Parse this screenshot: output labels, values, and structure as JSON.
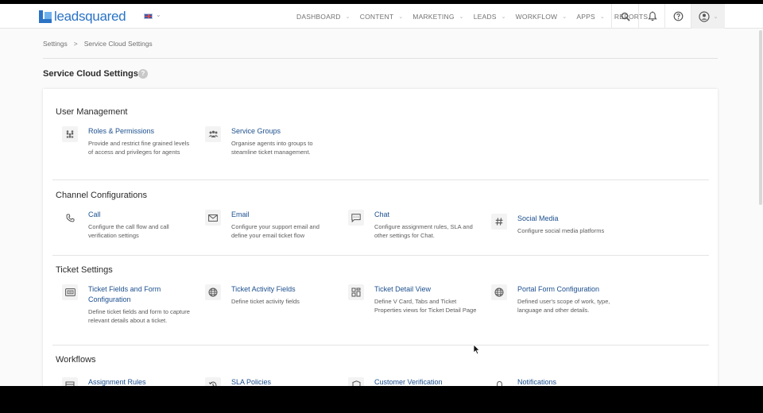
{
  "header": {
    "logo_text": "leadsquared",
    "nav": [
      "DASHBOARD",
      "CONTENT",
      "MARKETING",
      "LEADS",
      "WORKFLOW",
      "APPS",
      "REPORTS"
    ],
    "icons": [
      "search-icon",
      "bell-icon",
      "help-icon",
      "user-icon"
    ]
  },
  "breadcrumb": {
    "root": "Settings",
    "separator": ">",
    "current": "Service Cloud Settings"
  },
  "page": {
    "title": "Service Cloud Settings",
    "help_glyph": "?"
  },
  "sections": {
    "user_management": {
      "title": "User Management",
      "items": [
        {
          "title": "Roles & Permissions",
          "desc": "Provide and restrict fine grained levels of access and privileges for agents",
          "icon": "roles-icon"
        },
        {
          "title": "Service Groups",
          "desc": "Organise agents into groups to steamline ticket management.",
          "icon": "groups-icon"
        }
      ]
    },
    "channel_configurations": {
      "title": "Channel Configurations",
      "items": [
        {
          "title": "Call",
          "desc": "Configure the call flow and call verification settings",
          "icon": "phone-icon"
        },
        {
          "title": "Email",
          "desc": "Configure your support email and define your email ticket flow",
          "icon": "mail-icon"
        },
        {
          "title": "Chat",
          "desc": "Configure assignment rules, SLA and other settings for Chat.",
          "icon": "chat-icon"
        },
        {
          "title": "Social Media",
          "desc": "Configure social media platforms",
          "icon": "hashtag-icon"
        }
      ]
    },
    "ticket_settings": {
      "title": "Ticket Settings",
      "items": [
        {
          "title": "Ticket Fields and Form Configuration",
          "desc": "Define ticket fields and form to capture relevant details about a ticket.",
          "icon": "form-icon"
        },
        {
          "title": "Ticket Activity Fields",
          "desc": "Define ticket activity fields",
          "icon": "globe-icon"
        },
        {
          "title": "Ticket Detail View",
          "desc": "Define V Card, Tabs and Ticket Properties views for Ticket Detail Page",
          "icon": "layout-icon"
        },
        {
          "title": "Portal Form Configuration",
          "desc": "Defined user's scope of work, type, language and other details.",
          "icon": "globe-icon"
        }
      ]
    },
    "workflows": {
      "title": "Workflows",
      "items": [
        {
          "title": "Assignment Rules",
          "icon": "assignment-icon"
        },
        {
          "title": "SLA Policies",
          "icon": "sla-icon"
        },
        {
          "title": "Customer Verification",
          "icon": "shield-icon"
        },
        {
          "title": "Notifications",
          "icon": "bell-icon"
        }
      ]
    }
  },
  "colors": {
    "brand": "#2a73c5",
    "link": "#1c4f8e",
    "text": "#2b2b2b",
    "muted": "#5c5c5c"
  }
}
